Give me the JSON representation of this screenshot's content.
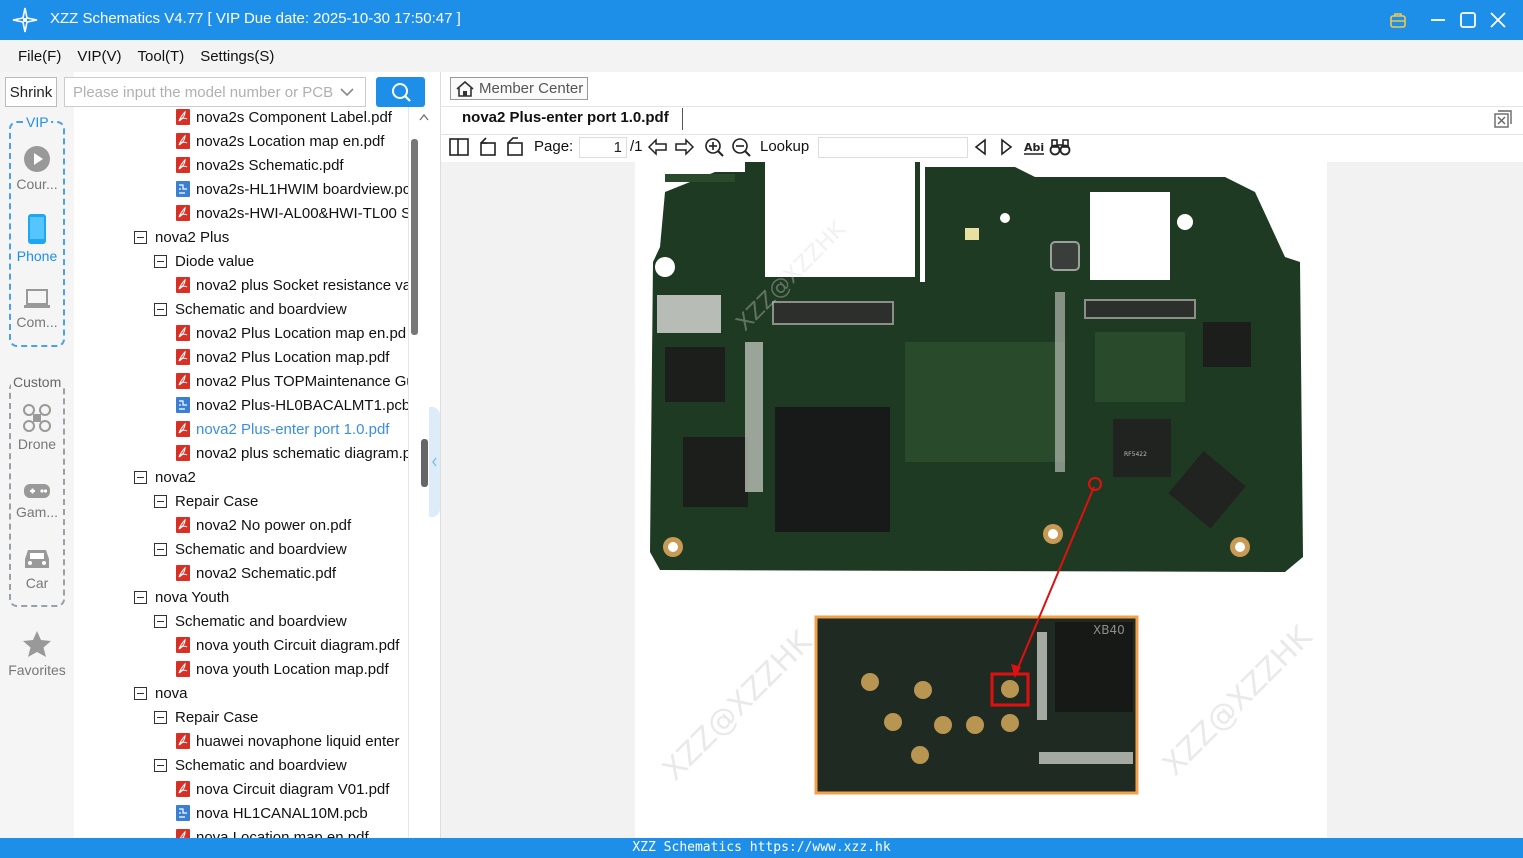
{
  "window": {
    "title": "XZZ Schematics V4.77 [ VIP Due date: 2025-10-30 17:50:47 ]"
  },
  "menu": [
    "File(F)",
    "VIP(V)",
    "Tool(T)",
    "Settings(S)"
  ],
  "sidebar": {
    "shrink_label": "Shrink",
    "vip_label": "VIP",
    "custom_label": "Custom",
    "vip_items": [
      {
        "label": "Cour...",
        "icon": "play-circle-icon"
      },
      {
        "label": "Phone",
        "icon": "phone-icon",
        "active": true
      },
      {
        "label": "Com...",
        "icon": "laptop-icon"
      }
    ],
    "custom_items": [
      {
        "label": "Drone",
        "icon": "drone-icon"
      },
      {
        "label": "Gam...",
        "icon": "gamepad-icon"
      },
      {
        "label": "Car",
        "icon": "car-icon"
      }
    ],
    "favorites_label": "Favorites"
  },
  "search": {
    "placeholder": "Please input the model number or PCB"
  },
  "tree": [
    {
      "level": 2,
      "type": "pdf",
      "label": "nova2s Component Label.pdf"
    },
    {
      "level": 2,
      "type": "pdf",
      "label": "nova2s Location map en.pdf"
    },
    {
      "level": 2,
      "type": "pdf",
      "label": "nova2s Schematic.pdf"
    },
    {
      "level": 2,
      "type": "pcb",
      "label": "nova2s-HL1HWIM boardview.pc"
    },
    {
      "level": 2,
      "type": "pdf",
      "label": "nova2s-HWI-AL00&HWI-TL00 S"
    },
    {
      "level": 0,
      "type": "folder",
      "label": "nova2 Plus"
    },
    {
      "level": 1,
      "type": "folder",
      "label": "Diode value"
    },
    {
      "level": 2,
      "type": "pdf",
      "label": "nova2 plus Socket resistance va"
    },
    {
      "level": 1,
      "type": "folder",
      "label": "Schematic and boardview"
    },
    {
      "level": 2,
      "type": "pdf",
      "label": "nova2 Plus Location map en.pd"
    },
    {
      "level": 2,
      "type": "pdf",
      "label": "nova2 Plus Location map.pdf"
    },
    {
      "level": 2,
      "type": "pdf",
      "label": "nova2 Plus TOPMaintenance Gu"
    },
    {
      "level": 2,
      "type": "pcb",
      "label": "nova2 Plus-HL0BACALMT1.pcb"
    },
    {
      "level": 2,
      "type": "pdf",
      "label": "nova2 Plus-enter port 1.0.pdf",
      "selected": true
    },
    {
      "level": 2,
      "type": "pdf",
      "label": "nova2 plus schematic diagram.p"
    },
    {
      "level": 0,
      "type": "folder",
      "label": "nova2"
    },
    {
      "level": 1,
      "type": "folder",
      "label": "Repair Case"
    },
    {
      "level": 2,
      "type": "pdf",
      "label": "nova2 No power on.pdf"
    },
    {
      "level": 1,
      "type": "folder",
      "label": "Schematic and boardview"
    },
    {
      "level": 2,
      "type": "pdf",
      "label": "nova2 Schematic.pdf"
    },
    {
      "level": 0,
      "type": "folder",
      "label": "nova Youth"
    },
    {
      "level": 1,
      "type": "folder",
      "label": "Schematic and boardview"
    },
    {
      "level": 2,
      "type": "pdf",
      "label": "nova youth Circuit diagram.pdf"
    },
    {
      "level": 2,
      "type": "pdf",
      "label": "nova youth Location map.pdf"
    },
    {
      "level": 0,
      "type": "folder",
      "label": "nova"
    },
    {
      "level": 1,
      "type": "folder",
      "label": "Repair Case"
    },
    {
      "level": 2,
      "type": "pdf",
      "label": "huawei novaphone liquid enter"
    },
    {
      "level": 1,
      "type": "folder",
      "label": "Schematic and boardview"
    },
    {
      "level": 2,
      "type": "pdf",
      "label": "nova Circuit diagram V01.pdf"
    },
    {
      "level": 2,
      "type": "pcb",
      "label": "nova HL1CANAL10M.pcb"
    },
    {
      "level": 2,
      "type": "pdf",
      "label": "nova Location map en.pdf"
    }
  ],
  "viewer": {
    "member_center": "Member Center",
    "tab_title": "nova2 Plus-enter port 1.0.pdf",
    "page_label": "Page:",
    "page_current": "1",
    "page_total": "/1",
    "lookup_label": "Lookup",
    "watermark": "XZZ@XZZHK",
    "chip_marks": [
      "RF5422",
      "XB40"
    ]
  },
  "status": {
    "text": "XZZ Schematics https://www.xzz.hk"
  },
  "colors": {
    "accent": "#1e8fe8",
    "selected_text": "#3a8fe0",
    "pcb_green": "#1f3a22",
    "highlight_red": "#e01010",
    "zoom_border": "#f2a14a"
  }
}
